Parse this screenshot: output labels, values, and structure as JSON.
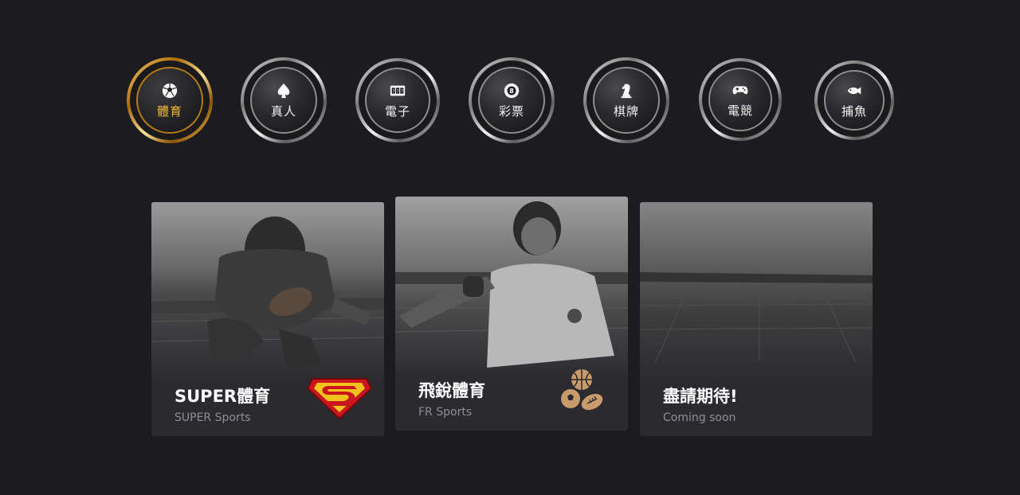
{
  "categories": [
    {
      "label": "體育",
      "icon": "soccer-ball-icon",
      "active": true
    },
    {
      "label": "真人",
      "icon": "spade-icon",
      "active": false
    },
    {
      "label": "電子",
      "icon": "slot-machine-icon",
      "active": false
    },
    {
      "label": "彩票",
      "icon": "lottery-ball-icon",
      "active": false
    },
    {
      "label": "棋牌",
      "icon": "chess-knight-icon",
      "active": false
    },
    {
      "label": "電競",
      "icon": "gamepad-icon",
      "active": false
    },
    {
      "label": "捕魚",
      "icon": "fish-icon",
      "active": false
    }
  ],
  "cards": [
    {
      "title": "SUPER體育",
      "subtitle": "SUPER Sports",
      "logo": "superman-logo"
    },
    {
      "title": "飛銳體育",
      "subtitle": "FR Sports",
      "logo": "sports-balls-logo"
    },
    {
      "title": "盡請期待!",
      "subtitle": "Coming soon",
      "logo": ""
    }
  ],
  "colors": {
    "background": "#1c1b20",
    "card": "#2b2a2f",
    "active_gold": "#f0b83a",
    "subtitle": "#8f8e95"
  }
}
